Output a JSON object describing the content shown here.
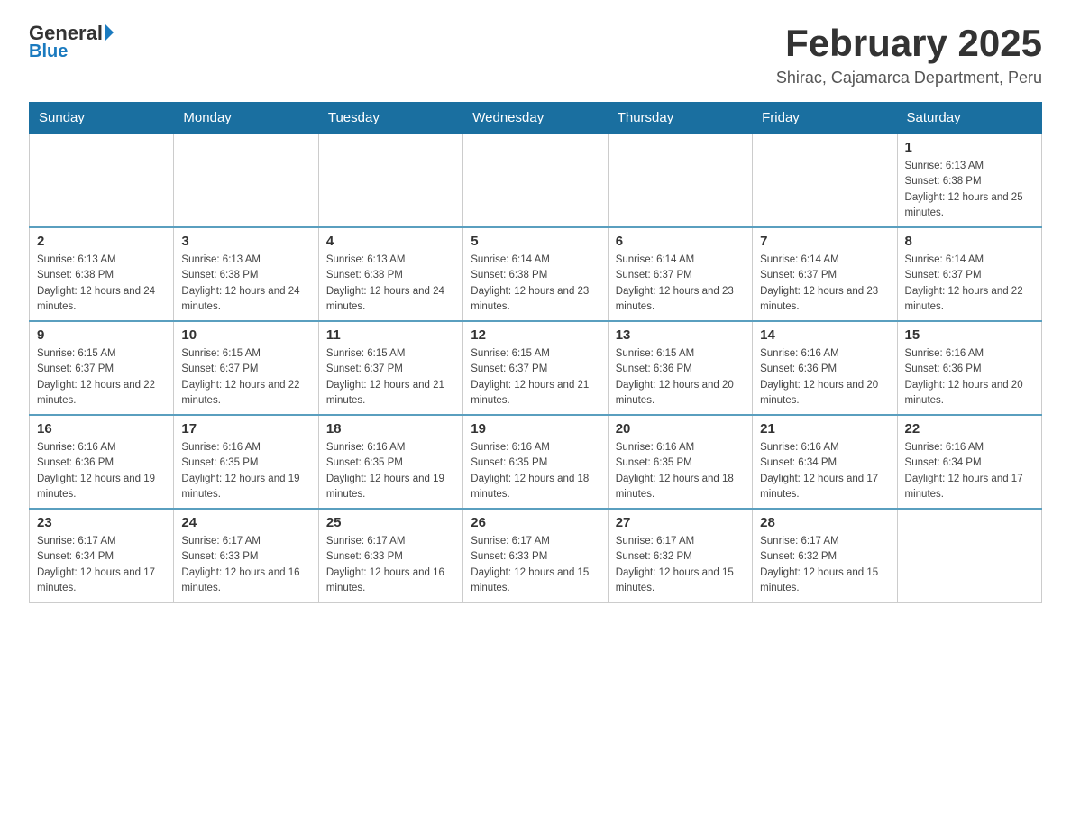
{
  "header": {
    "logo_general": "General",
    "logo_blue": "Blue",
    "main_title": "February 2025",
    "subtitle": "Shirac, Cajamarca Department, Peru"
  },
  "days_of_week": [
    "Sunday",
    "Monday",
    "Tuesday",
    "Wednesday",
    "Thursday",
    "Friday",
    "Saturday"
  ],
  "weeks": [
    {
      "days": [
        {
          "number": "",
          "info": ""
        },
        {
          "number": "",
          "info": ""
        },
        {
          "number": "",
          "info": ""
        },
        {
          "number": "",
          "info": ""
        },
        {
          "number": "",
          "info": ""
        },
        {
          "number": "",
          "info": ""
        },
        {
          "number": "1",
          "sunrise": "Sunrise: 6:13 AM",
          "sunset": "Sunset: 6:38 PM",
          "daylight": "Daylight: 12 hours and 25 minutes."
        }
      ]
    },
    {
      "days": [
        {
          "number": "2",
          "sunrise": "Sunrise: 6:13 AM",
          "sunset": "Sunset: 6:38 PM",
          "daylight": "Daylight: 12 hours and 24 minutes."
        },
        {
          "number": "3",
          "sunrise": "Sunrise: 6:13 AM",
          "sunset": "Sunset: 6:38 PM",
          "daylight": "Daylight: 12 hours and 24 minutes."
        },
        {
          "number": "4",
          "sunrise": "Sunrise: 6:13 AM",
          "sunset": "Sunset: 6:38 PM",
          "daylight": "Daylight: 12 hours and 24 minutes."
        },
        {
          "number": "5",
          "sunrise": "Sunrise: 6:14 AM",
          "sunset": "Sunset: 6:38 PM",
          "daylight": "Daylight: 12 hours and 23 minutes."
        },
        {
          "number": "6",
          "sunrise": "Sunrise: 6:14 AM",
          "sunset": "Sunset: 6:37 PM",
          "daylight": "Daylight: 12 hours and 23 minutes."
        },
        {
          "number": "7",
          "sunrise": "Sunrise: 6:14 AM",
          "sunset": "Sunset: 6:37 PM",
          "daylight": "Daylight: 12 hours and 23 minutes."
        },
        {
          "number": "8",
          "sunrise": "Sunrise: 6:14 AM",
          "sunset": "Sunset: 6:37 PM",
          "daylight": "Daylight: 12 hours and 22 minutes."
        }
      ]
    },
    {
      "days": [
        {
          "number": "9",
          "sunrise": "Sunrise: 6:15 AM",
          "sunset": "Sunset: 6:37 PM",
          "daylight": "Daylight: 12 hours and 22 minutes."
        },
        {
          "number": "10",
          "sunrise": "Sunrise: 6:15 AM",
          "sunset": "Sunset: 6:37 PM",
          "daylight": "Daylight: 12 hours and 22 minutes."
        },
        {
          "number": "11",
          "sunrise": "Sunrise: 6:15 AM",
          "sunset": "Sunset: 6:37 PM",
          "daylight": "Daylight: 12 hours and 21 minutes."
        },
        {
          "number": "12",
          "sunrise": "Sunrise: 6:15 AM",
          "sunset": "Sunset: 6:37 PM",
          "daylight": "Daylight: 12 hours and 21 minutes."
        },
        {
          "number": "13",
          "sunrise": "Sunrise: 6:15 AM",
          "sunset": "Sunset: 6:36 PM",
          "daylight": "Daylight: 12 hours and 20 minutes."
        },
        {
          "number": "14",
          "sunrise": "Sunrise: 6:16 AM",
          "sunset": "Sunset: 6:36 PM",
          "daylight": "Daylight: 12 hours and 20 minutes."
        },
        {
          "number": "15",
          "sunrise": "Sunrise: 6:16 AM",
          "sunset": "Sunset: 6:36 PM",
          "daylight": "Daylight: 12 hours and 20 minutes."
        }
      ]
    },
    {
      "days": [
        {
          "number": "16",
          "sunrise": "Sunrise: 6:16 AM",
          "sunset": "Sunset: 6:36 PM",
          "daylight": "Daylight: 12 hours and 19 minutes."
        },
        {
          "number": "17",
          "sunrise": "Sunrise: 6:16 AM",
          "sunset": "Sunset: 6:35 PM",
          "daylight": "Daylight: 12 hours and 19 minutes."
        },
        {
          "number": "18",
          "sunrise": "Sunrise: 6:16 AM",
          "sunset": "Sunset: 6:35 PM",
          "daylight": "Daylight: 12 hours and 19 minutes."
        },
        {
          "number": "19",
          "sunrise": "Sunrise: 6:16 AM",
          "sunset": "Sunset: 6:35 PM",
          "daylight": "Daylight: 12 hours and 18 minutes."
        },
        {
          "number": "20",
          "sunrise": "Sunrise: 6:16 AM",
          "sunset": "Sunset: 6:35 PM",
          "daylight": "Daylight: 12 hours and 18 minutes."
        },
        {
          "number": "21",
          "sunrise": "Sunrise: 6:16 AM",
          "sunset": "Sunset: 6:34 PM",
          "daylight": "Daylight: 12 hours and 17 minutes."
        },
        {
          "number": "22",
          "sunrise": "Sunrise: 6:16 AM",
          "sunset": "Sunset: 6:34 PM",
          "daylight": "Daylight: 12 hours and 17 minutes."
        }
      ]
    },
    {
      "days": [
        {
          "number": "23",
          "sunrise": "Sunrise: 6:17 AM",
          "sunset": "Sunset: 6:34 PM",
          "daylight": "Daylight: 12 hours and 17 minutes."
        },
        {
          "number": "24",
          "sunrise": "Sunrise: 6:17 AM",
          "sunset": "Sunset: 6:33 PM",
          "daylight": "Daylight: 12 hours and 16 minutes."
        },
        {
          "number": "25",
          "sunrise": "Sunrise: 6:17 AM",
          "sunset": "Sunset: 6:33 PM",
          "daylight": "Daylight: 12 hours and 16 minutes."
        },
        {
          "number": "26",
          "sunrise": "Sunrise: 6:17 AM",
          "sunset": "Sunset: 6:33 PM",
          "daylight": "Daylight: 12 hours and 15 minutes."
        },
        {
          "number": "27",
          "sunrise": "Sunrise: 6:17 AM",
          "sunset": "Sunset: 6:32 PM",
          "daylight": "Daylight: 12 hours and 15 minutes."
        },
        {
          "number": "28",
          "sunrise": "Sunrise: 6:17 AM",
          "sunset": "Sunset: 6:32 PM",
          "daylight": "Daylight: 12 hours and 15 minutes."
        },
        {
          "number": "",
          "info": ""
        }
      ]
    }
  ]
}
